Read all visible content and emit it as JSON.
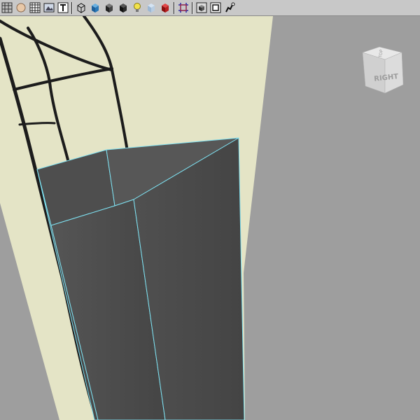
{
  "toolbar": {
    "buttons": [
      {
        "icon": "grid-icon"
      },
      {
        "icon": "sphere-icon"
      },
      {
        "icon": "texture-grid-icon"
      },
      {
        "icon": "image-plane-icon"
      },
      {
        "icon": "text-T-icon"
      },
      {
        "icon": "wireframe-cube-icon"
      },
      {
        "icon": "shaded-cube-icon"
      },
      {
        "icon": "dark-cube-icon"
      },
      {
        "icon": "shadow-cube-icon"
      },
      {
        "icon": "light-bulb-icon"
      },
      {
        "icon": "xray-cube-icon"
      },
      {
        "icon": "red-cube-icon"
      },
      {
        "icon": "resolution-gate-icon"
      },
      {
        "icon": "isolate-cube-icon"
      },
      {
        "icon": "film-gate-icon"
      },
      {
        "icon": "hud-icon"
      }
    ]
  },
  "viewcube": {
    "face_label": "RIGHT",
    "top_label": "TOP"
  },
  "colors": {
    "background": "#9e9e9e",
    "image_plane": "#e4e4c6",
    "mesh": "#4a4a4a",
    "mesh_edge": "#7ee0f0",
    "reference_lines": "#1c1c1c"
  }
}
